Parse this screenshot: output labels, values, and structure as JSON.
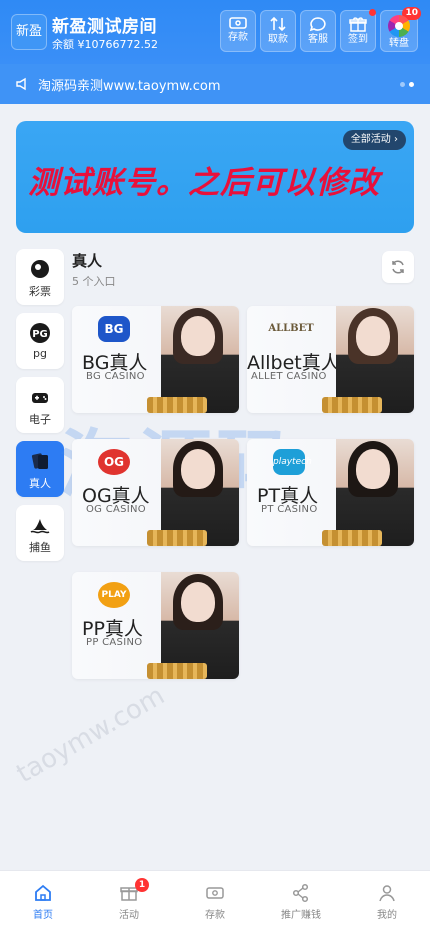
{
  "header": {
    "logo_text": "新盈",
    "room_title": "新盈测试房间",
    "balance_label": "余额",
    "balance": "¥10766772.52",
    "buttons": [
      {
        "label": "存款",
        "icon": "cash-icon"
      },
      {
        "label": "取款",
        "icon": "transfer-icon"
      },
      {
        "label": "客服",
        "icon": "chat-icon"
      },
      {
        "label": "签到",
        "icon": "gift-icon"
      },
      {
        "label": "转盘",
        "icon": "wheel-icon",
        "badge": "10"
      }
    ]
  },
  "notice": {
    "text": "淘源码亲测www.taoymw.com"
  },
  "banner": {
    "text": "测试账号。之后可以修改",
    "all_activities": "全部活动"
  },
  "categories": [
    {
      "label": "彩票",
      "icon": "lottery-ball-icon"
    },
    {
      "label": "pg",
      "icon": "pg-icon"
    },
    {
      "label": "电子",
      "icon": "gamepad-icon"
    },
    {
      "label": "真人",
      "icon": "cards-icon",
      "active": true
    },
    {
      "label": "捕鱼",
      "icon": "shark-fin-icon"
    }
  ],
  "section": {
    "title": "真人",
    "subtitle": "5 个入口"
  },
  "games": [
    {
      "name": "BG真人",
      "sub": "BG CASINO",
      "logo": "BG"
    },
    {
      "name": "Allbet真人",
      "sub": "ALLET CASINO",
      "logo": "ALLBET"
    },
    {
      "name": "OG真人",
      "sub": "OG CASINO",
      "logo": "OG"
    },
    {
      "name": "PT真人",
      "sub": "PT CASINO",
      "logo": "playtech"
    },
    {
      "name": "PP真人",
      "sub": "PP CASINO",
      "logo": "PLAY"
    }
  ],
  "watermark": {
    "main": "淘源码",
    "small": "taoymw.com"
  },
  "nav": [
    {
      "label": "首页",
      "icon": "home-icon",
      "active": true
    },
    {
      "label": "活动",
      "icon": "gift-icon",
      "badge": "1"
    },
    {
      "label": "存款",
      "icon": "wallet-icon"
    },
    {
      "label": "推广赚钱",
      "icon": "share-icon"
    },
    {
      "label": "我的",
      "icon": "user-icon"
    }
  ],
  "colors": {
    "primary": "#2d7cf3",
    "header": "#3a8ff7",
    "banner_text": "#e8103b"
  }
}
